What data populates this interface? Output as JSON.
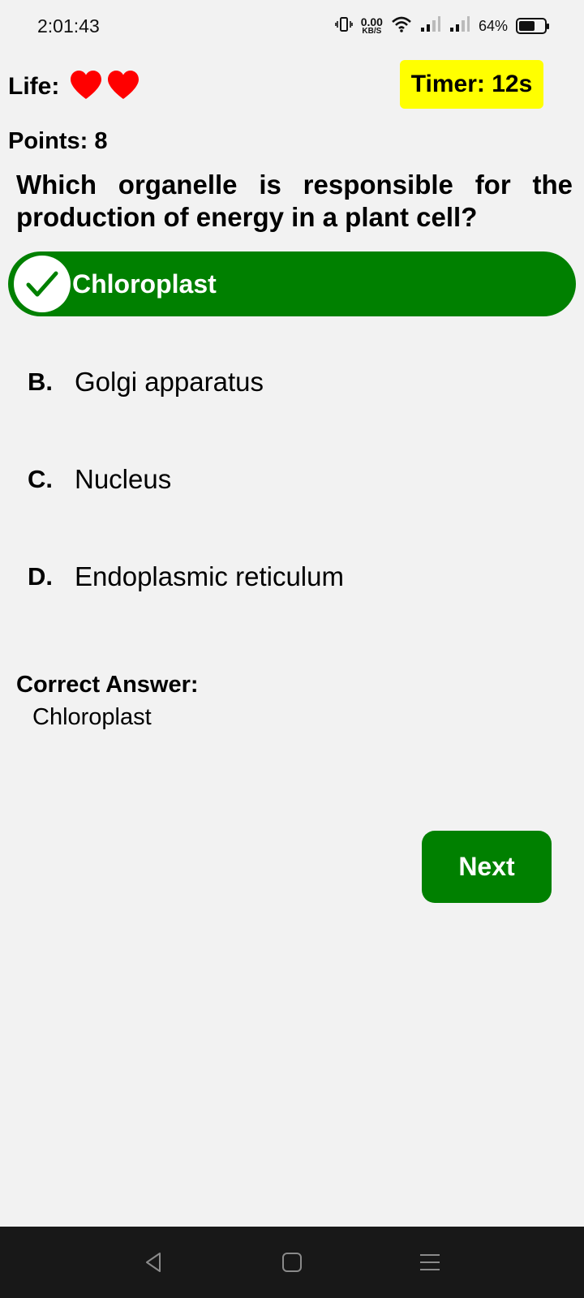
{
  "status_bar": {
    "time": "2:01:43",
    "net_speed_value": "0.00",
    "net_speed_unit": "KB/S",
    "battery_percent": "64%",
    "battery_level": 0.64,
    "icons": [
      "vibrate-icon",
      "wifi-icon",
      "signal-icon",
      "signal-icon",
      "battery-icon"
    ]
  },
  "game": {
    "life_label": "Life:",
    "lives": 2,
    "timer_label": "Timer: 12s",
    "points_label": "Points: 8"
  },
  "question": {
    "text": "Which organelle is responsible for the production of energy in a plant cell?"
  },
  "options": {
    "a": {
      "text": "Chloroplast",
      "state": "correct-selected"
    },
    "b": {
      "letter": "B.",
      "text": "Golgi apparatus"
    },
    "c": {
      "letter": "C.",
      "text": "Nucleus"
    },
    "d": {
      "letter": "D.",
      "text": "Endoplasmic reticulum"
    }
  },
  "answer": {
    "label": "Correct Answer:",
    "value": "Chloroplast"
  },
  "actions": {
    "next_label": "Next"
  },
  "colors": {
    "background": "#f2f2f2",
    "correct_green": "#008000",
    "timer_yellow": "#ffff00",
    "heart_red": "#ff0000",
    "nav_bar": "#181818"
  },
  "nav_bar": {
    "icons": [
      "back-icon",
      "home-icon",
      "menu-icon"
    ]
  }
}
